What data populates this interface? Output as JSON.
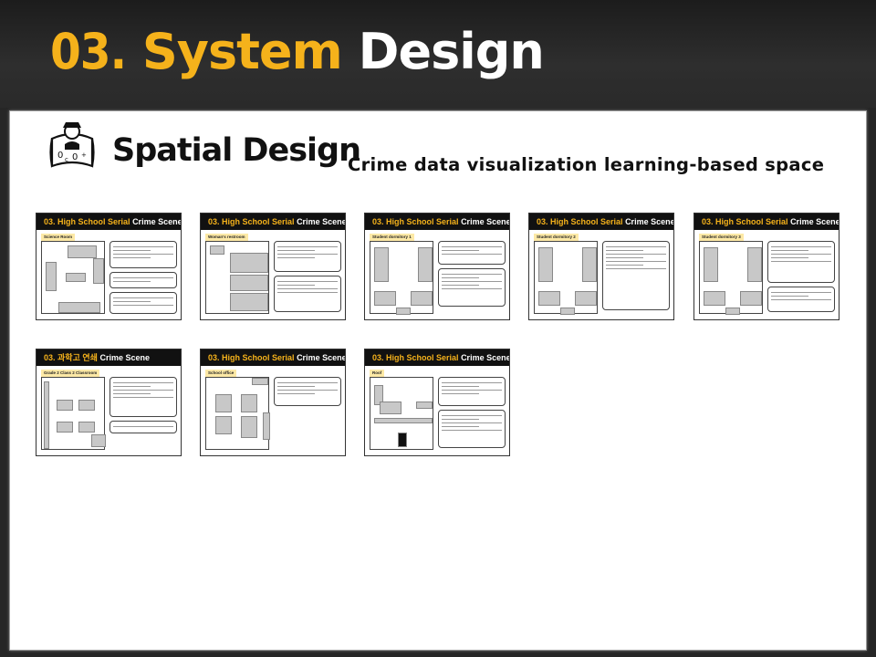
{
  "header": {
    "num": "03.",
    "word1": "System",
    "word2": "Design"
  },
  "section": {
    "title": "Spatial Design",
    "caption": "Crime data visualization learning-based space"
  },
  "slides": [
    {
      "prefix": "03.",
      "title": "High School Serial",
      "suffix": "Crime Scene",
      "room": "Science Room"
    },
    {
      "prefix": "03.",
      "title": "High School Serial",
      "suffix": "Crime Scene",
      "room": "Woman's restroom"
    },
    {
      "prefix": "03.",
      "title": "High School Serial",
      "suffix": "Crime Scene",
      "room": "Student dormitory 1"
    },
    {
      "prefix": "03.",
      "title": "High School Serial",
      "suffix": "Crime Scene",
      "room": "Student dormitory 2"
    },
    {
      "prefix": "03.",
      "title": "High School Serial",
      "suffix": "Crime Scene",
      "room": "Student dormitory 3"
    },
    {
      "prefix": "03.",
      "title": "과학고 연쇄",
      "suffix": "Crime Scene",
      "room": "Grade 2 Class 2 Classroom"
    },
    {
      "prefix": "03.",
      "title": "High School Serial",
      "suffix": "Crime Scene",
      "room": "School office"
    },
    {
      "prefix": "03.",
      "title": "High School Serial",
      "suffix": "Crime Scene",
      "room": "Roof"
    }
  ]
}
